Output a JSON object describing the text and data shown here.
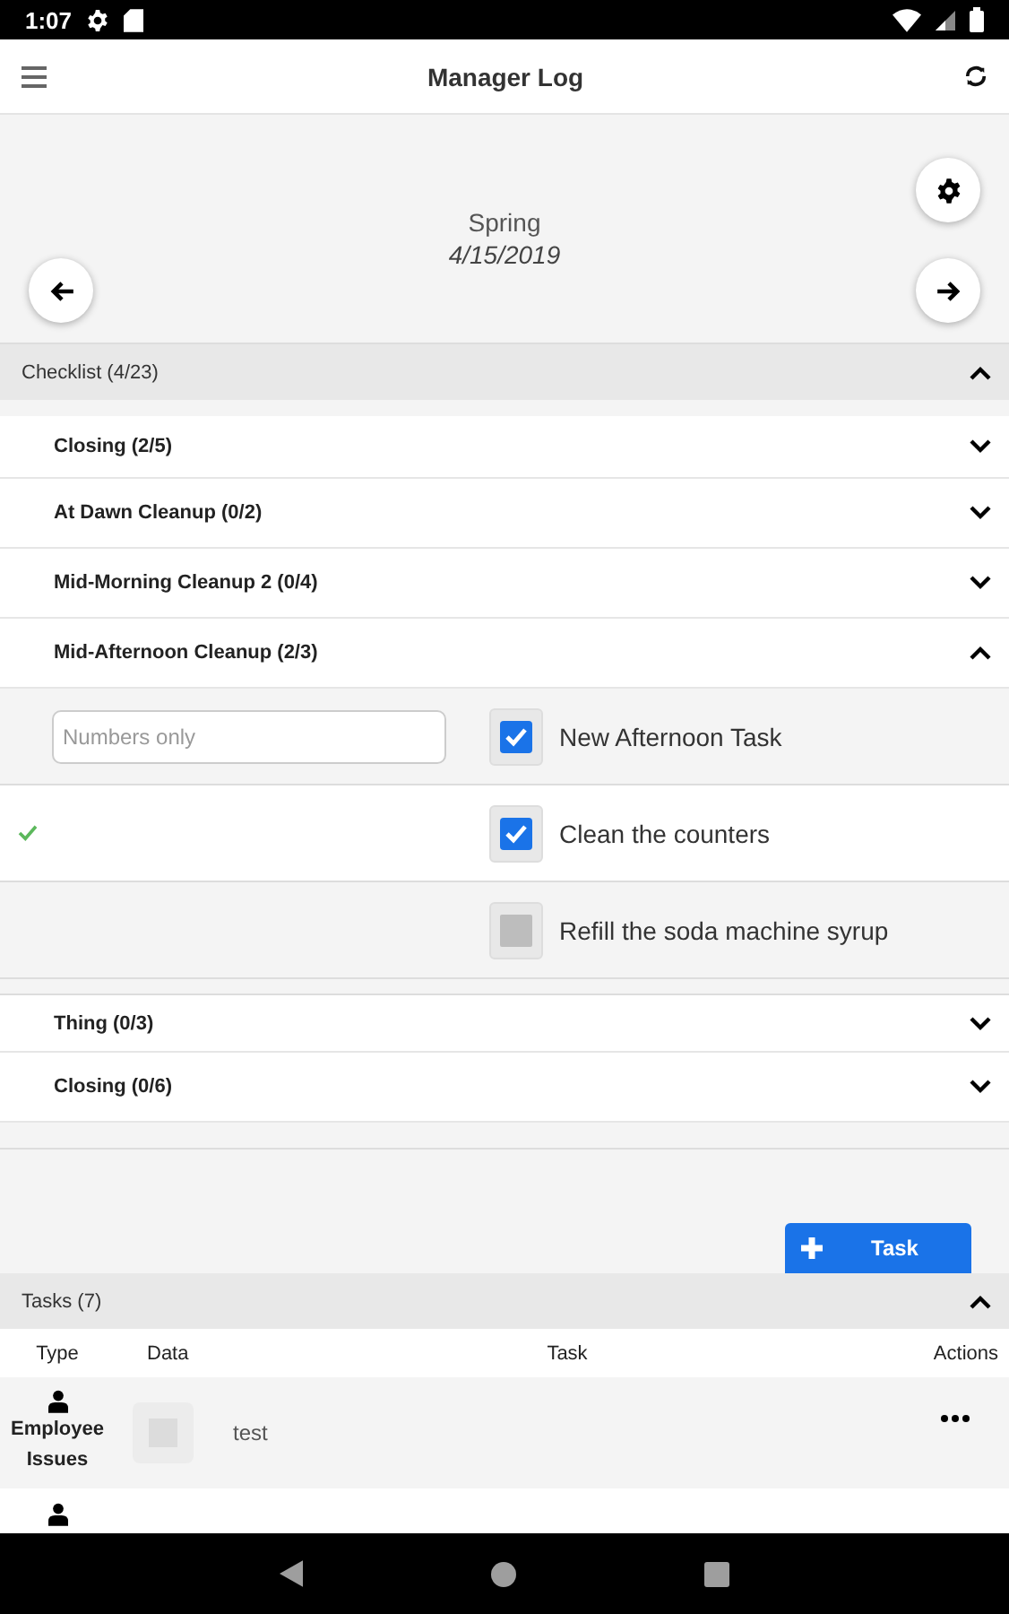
{
  "status_bar": {
    "time": "1:07"
  },
  "app_bar": {
    "title": "Manager Log"
  },
  "period": {
    "season": "Spring",
    "date": "4/15/2019"
  },
  "checklist": {
    "title": "Checklist (4/23)",
    "expanded": true,
    "sections": [
      {
        "title": "Closing (2/5)",
        "expanded": false
      },
      {
        "title": "At Dawn Cleanup (0/2)",
        "expanded": false
      },
      {
        "title": "Mid-Morning Cleanup 2 (0/4)",
        "expanded": false
      },
      {
        "title": "Mid-Afternoon Cleanup (2/3)",
        "expanded": true,
        "tasks": [
          {
            "kind": "number_input",
            "placeholder": "Numbers only",
            "label": "New Afternoon Task",
            "checked": true
          },
          {
            "kind": "done_mark",
            "label": "Clean the counters",
            "checked": true
          },
          {
            "kind": "plain",
            "label": "Refill the soda machine syrup",
            "checked": false
          }
        ]
      },
      {
        "title": "Thing (0/3)",
        "expanded": false
      },
      {
        "title": "Closing (0/6)",
        "expanded": false
      }
    ]
  },
  "add_task_button": {
    "label": "Task"
  },
  "tasks": {
    "title": "Tasks (7)",
    "expanded": true,
    "columns": [
      "Type",
      "Data",
      "Task",
      "Actions"
    ],
    "rows": [
      {
        "type": "Employee Issues",
        "task": "test"
      }
    ]
  }
}
